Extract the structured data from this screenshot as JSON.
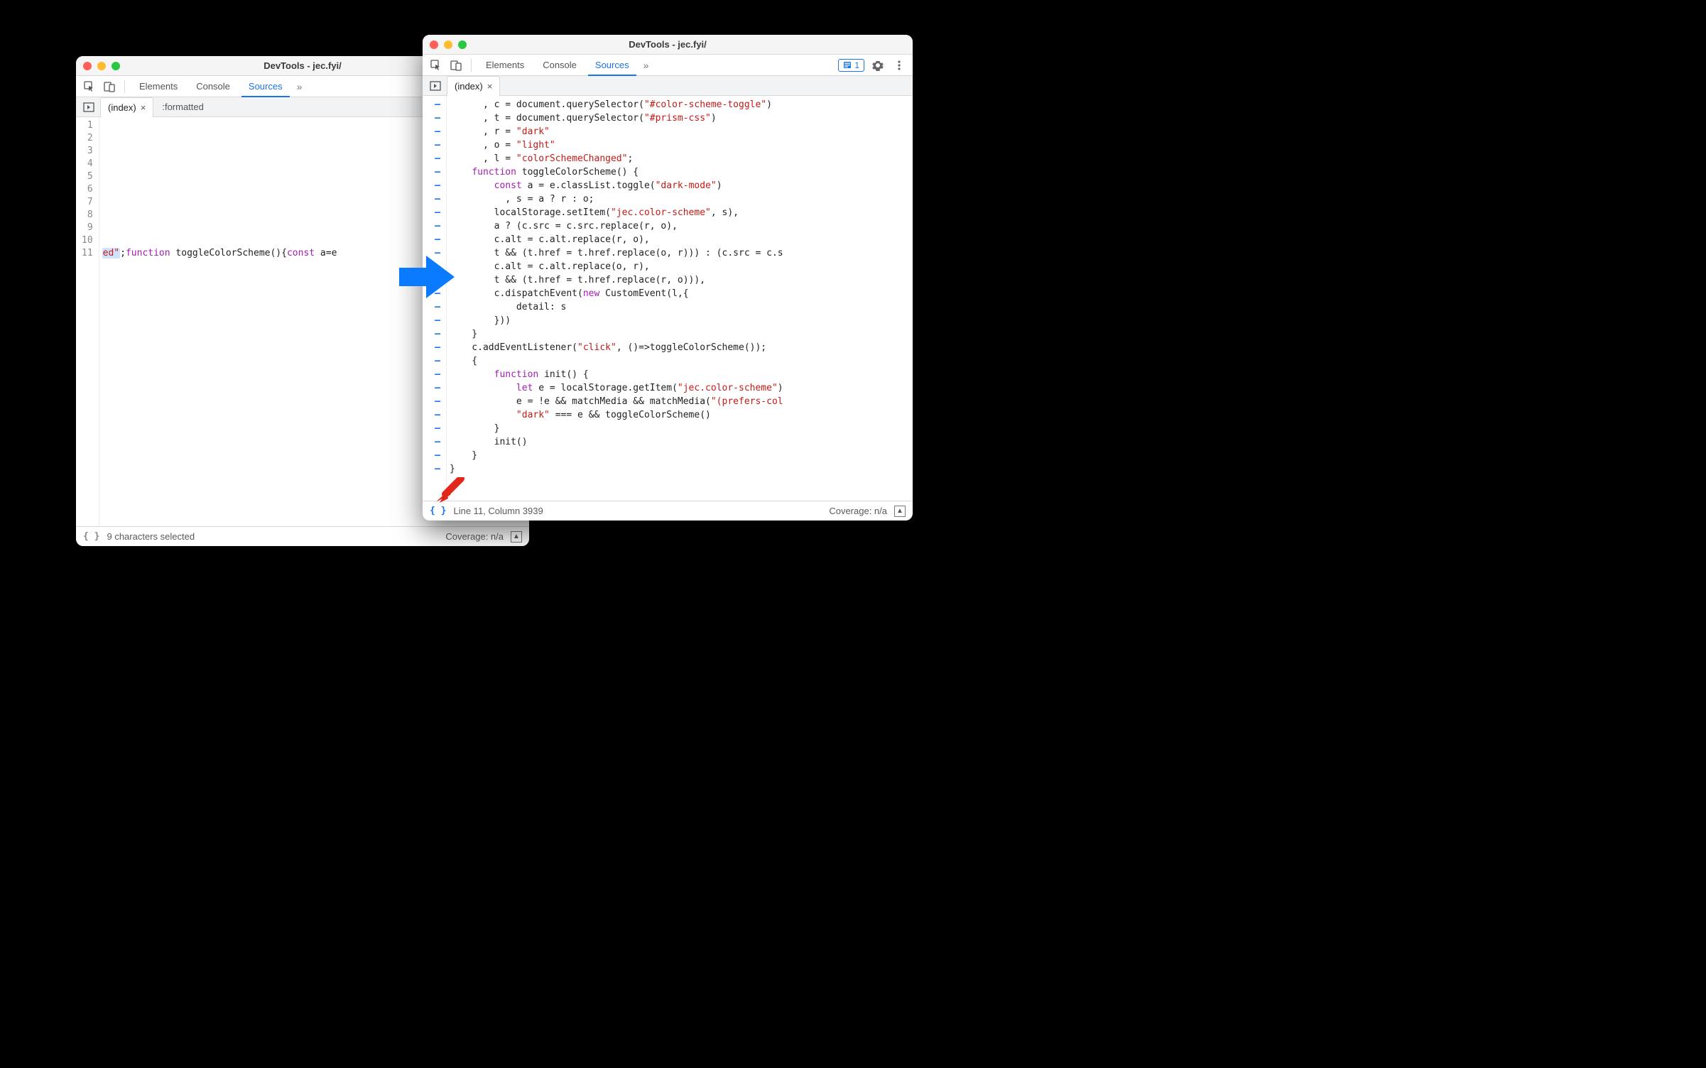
{
  "common": {
    "window_title": "DevTools - jec.fyi/",
    "tabs": {
      "elements": "Elements",
      "console": "Console",
      "sources": "Sources"
    },
    "file_tab": "(index)",
    "chevrons": "»",
    "coverage_label": "Coverage: n/a"
  },
  "left": {
    "sub_extra": ":formatted",
    "gutter": [
      "1",
      "2",
      "3",
      "4",
      "5",
      "6",
      "7",
      "8",
      "9",
      "10",
      "11"
    ],
    "code_line11": {
      "seg1": "ed\"",
      "seg2": ";",
      "kw1": "function",
      "fn": " toggleColorScheme(){",
      "kw2": "const",
      "rest": " a=e"
    },
    "status_text": "9 characters selected"
  },
  "right": {
    "issues_count": "1",
    "dash_count": 28,
    "status_text": "Line 11, Column 3939",
    "code": [
      [
        [
          "p",
          "      , c = document.querySelector("
        ],
        [
          "s",
          "\"#color-scheme-toggle\""
        ],
        [
          "p",
          ")"
        ]
      ],
      [
        [
          "p",
          "      , t = document.querySelector("
        ],
        [
          "s",
          "\"#prism-css\""
        ],
        [
          "p",
          ")"
        ]
      ],
      [
        [
          "p",
          "      , r = "
        ],
        [
          "s",
          "\"dark\""
        ]
      ],
      [
        [
          "p",
          "      , o = "
        ],
        [
          "s",
          "\"light\""
        ]
      ],
      [
        [
          "p",
          "      , l = "
        ],
        [
          "s",
          "\"colorSchemeChanged\""
        ],
        [
          "p",
          ";"
        ]
      ],
      [
        [
          "p",
          "    "
        ],
        [
          "k",
          "function"
        ],
        [
          "p",
          " toggleColorScheme() {"
        ]
      ],
      [
        [
          "p",
          "        "
        ],
        [
          "k",
          "const"
        ],
        [
          "p",
          " a = e.classList.toggle("
        ],
        [
          "s",
          "\"dark-mode\""
        ],
        [
          "p",
          ")"
        ]
      ],
      [
        [
          "p",
          "          , s = a ? r : o;"
        ]
      ],
      [
        [
          "p",
          "        localStorage.setItem("
        ],
        [
          "s",
          "\"jec.color-scheme\""
        ],
        [
          "p",
          ", s),"
        ]
      ],
      [
        [
          "p",
          "        a ? (c.src = c.src.replace(r, o),"
        ]
      ],
      [
        [
          "p",
          "        c.alt = c.alt.replace(r, o),"
        ]
      ],
      [
        [
          "p",
          "        t && (t.href = t.href.replace(o, r))) : (c.src = c.s"
        ]
      ],
      [
        [
          "p",
          "        c.alt = c.alt.replace(o, r),"
        ]
      ],
      [
        [
          "p",
          "        t && (t.href = t.href.replace(r, o))),"
        ]
      ],
      [
        [
          "p",
          "        c.dispatchEvent("
        ],
        [
          "k",
          "new"
        ],
        [
          "p",
          " CustomEvent(l,{"
        ]
      ],
      [
        [
          "p",
          "            detail: s"
        ]
      ],
      [
        [
          "p",
          "        }))"
        ]
      ],
      [
        [
          "p",
          "    }"
        ]
      ],
      [
        [
          "p",
          "    c.addEventListener("
        ],
        [
          "s",
          "\"click\""
        ],
        [
          "p",
          ", ()=>toggleColorScheme());"
        ]
      ],
      [
        [
          "p",
          "    {"
        ]
      ],
      [
        [
          "p",
          "        "
        ],
        [
          "k",
          "function"
        ],
        [
          "p",
          " init() {"
        ]
      ],
      [
        [
          "p",
          "            "
        ],
        [
          "k",
          "let"
        ],
        [
          "p",
          " e = localStorage.getItem("
        ],
        [
          "s",
          "\"jec.color-scheme\""
        ],
        [
          "p",
          ")"
        ]
      ],
      [
        [
          "p",
          "            e = !e && matchMedia && matchMedia("
        ],
        [
          "s",
          "\"(prefers-col"
        ]
      ],
      [
        [
          "p",
          "            "
        ],
        [
          "s",
          "\"dark\""
        ],
        [
          "p",
          " === e && toggleColorScheme()"
        ]
      ],
      [
        [
          "p",
          "        }"
        ]
      ],
      [
        [
          "p",
          "        init()"
        ]
      ],
      [
        [
          "p",
          "    }"
        ]
      ],
      [
        [
          "p",
          "}"
        ]
      ]
    ]
  }
}
